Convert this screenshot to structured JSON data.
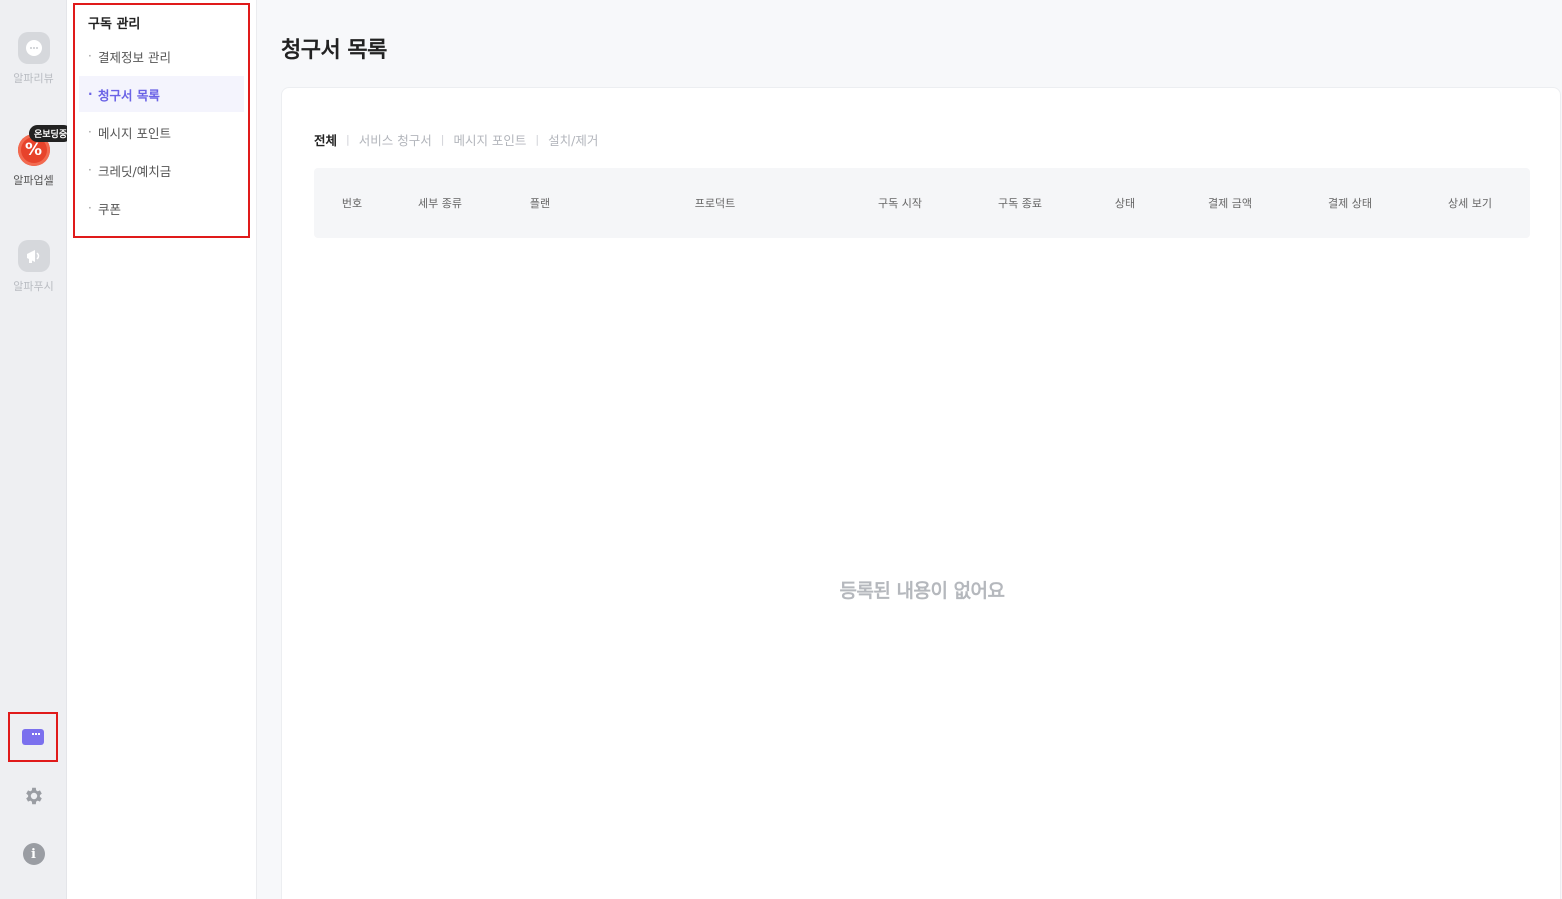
{
  "rail": {
    "review_label": "알파리뷰",
    "upsell_badge": "온보딩중",
    "upsell_icon": "%",
    "upsell_label": "알파업셀",
    "push_label": "알파푸시",
    "info_icon": "i"
  },
  "submenu": {
    "title": "구독 관리",
    "items": [
      {
        "label": "결제정보 관리"
      },
      {
        "label": "청구서 목록"
      },
      {
        "label": "메시지 포인트"
      },
      {
        "label": "크레딧/예치금"
      },
      {
        "label": "쿠폰"
      }
    ]
  },
  "main": {
    "title": "청구서 목록",
    "tabs": [
      {
        "label": "전체"
      },
      {
        "label": "서비스 청구서"
      },
      {
        "label": "메시지 포인트"
      },
      {
        "label": "설치/제거"
      }
    ],
    "columns": [
      "번호",
      "세부 종류",
      "플랜",
      "프로덕트",
      "구독 시작",
      "구독 종료",
      "상태",
      "결제 금액",
      "결제 상태",
      "상세 보기"
    ],
    "empty_message": "등록된 내용이 없어요"
  },
  "colors": {
    "accent": "#6b63e6",
    "highlight_border": "#e01a1a",
    "upsell_red": "#e7432b"
  }
}
